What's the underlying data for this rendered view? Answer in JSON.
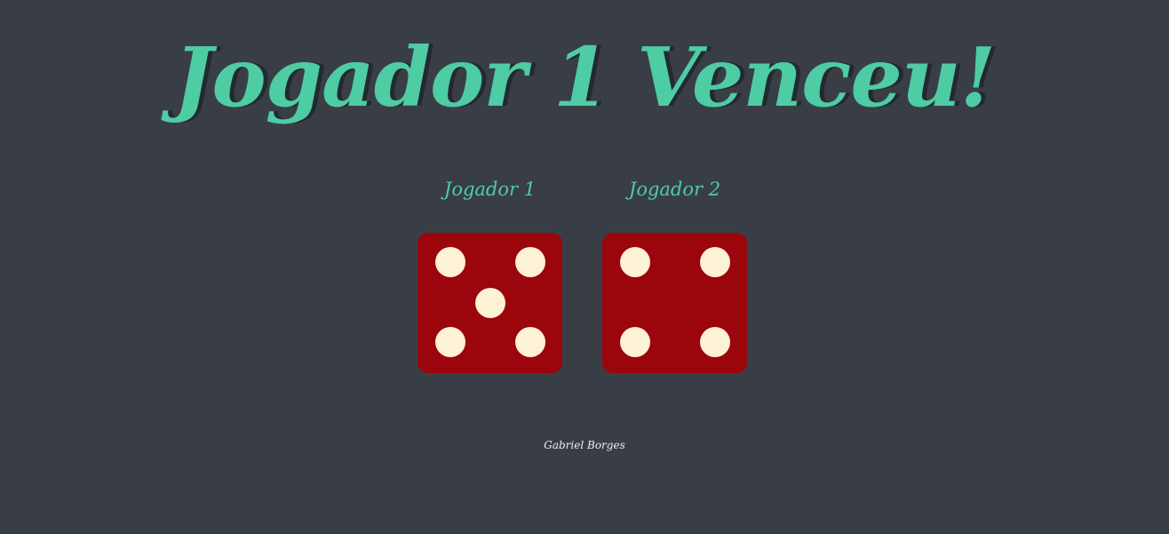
{
  "header": {
    "title": "Jogador 1 Venceu!"
  },
  "players": [
    {
      "name": "Jogador 1",
      "die_value": 5
    },
    {
      "name": "Jogador 2",
      "die_value": 4
    }
  ],
  "footer": {
    "author": "Gabriel Borges"
  },
  "colors": {
    "background": "#393e46",
    "accent": "#4ecca3",
    "title_shadow": "#232931",
    "die_face": "#9b050c",
    "pip": "#fdf1d6",
    "footer_text": "#eeeeee"
  }
}
